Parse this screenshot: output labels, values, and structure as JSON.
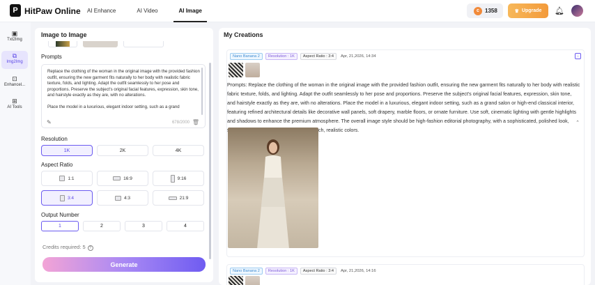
{
  "header": {
    "logo_glyph": "P",
    "brand": "HitPaw Online",
    "nav": [
      {
        "label": "AI Enhance",
        "active": false
      },
      {
        "label": "AI Video",
        "active": false
      },
      {
        "label": "AI Image",
        "active": true
      }
    ],
    "credits": "1358",
    "upgrade_label": "Upgrade"
  },
  "rail": [
    {
      "label": "Txt2Img",
      "icon": "text-image-icon",
      "active": false
    },
    {
      "label": "Img2Img",
      "icon": "image-image-icon",
      "active": true
    },
    {
      "label": "Enhancel...",
      "icon": "enhance-icon",
      "active": false
    },
    {
      "label": "AI Tools",
      "icon": "tools-grid-icon",
      "active": false
    }
  ],
  "left_panel": {
    "title": "Image to Image",
    "prompts_label": "Prompts",
    "prompt_text_p1": "Replace the clothing of the woman in the original image with the provided fashion outfit, ensuring the new garment fits naturally to her body with realistic fabric texture, folds, and lighting. Adapt the outfit seamlessly to her pose and proportions. Preserve the subject's original facial features, expression, skin tone, and hairstyle exactly as they are, with no alterations.",
    "prompt_text_p2": "Place the model in a luxurious, elegant indoor setting, such as a grand",
    "char_count": "678/2000",
    "resolution_label": "Resolution",
    "resolutions": [
      {
        "label": "1K",
        "selected": true
      },
      {
        "label": "2K",
        "selected": false
      },
      {
        "label": "4K",
        "selected": false
      }
    ],
    "aspect_label": "Aspect Ratio",
    "aspect_ratios": [
      {
        "label": "1:1",
        "selected": false
      },
      {
        "label": "16:9",
        "selected": false
      },
      {
        "label": "9:16",
        "selected": false
      },
      {
        "label": "3:4",
        "selected": true
      },
      {
        "label": "4:3",
        "selected": false
      },
      {
        "label": "21:9",
        "selected": false
      }
    ],
    "output_label": "Output Number",
    "outputs": [
      {
        "label": "1",
        "selected": true
      },
      {
        "label": "2",
        "selected": false
      },
      {
        "label": "3",
        "selected": false
      },
      {
        "label": "4",
        "selected": false
      }
    ],
    "credits_required": "Credits required: 5",
    "generate_label": "Generate"
  },
  "creations": {
    "title": "My Creations",
    "cards": [
      {
        "model_tag": "Nano Banana 2",
        "resolution_tag": "Resolution : 1K",
        "aspect_tag": "Aspect Ratio : 3:4",
        "date": "Apr, 21,2026, 14:34",
        "prompt": "Prompts: Replace the clothing of the woman in the original image with the provided fashion outfit, ensuring the new garment fits naturally to her body with realistic fabric texture, folds, and lighting. Adapt the outfit seamlessly to her pose and proportions. Preserve the subject's original facial features, expression, skin tone, and hairstyle exactly as they are, with no alterations. Place the model in a luxurious, elegant indoor setting, such as a grand salon or high-end classical interior, featuring refined architectural details like decorative wall panels, soft drapery, marble floors, or ornate furniture. Use soft, cinematic lighting with gentle highlights and shadows to enhance the premium atmosphere. The overall image style should be high-fashion editorial photography, with a sophisticated, polished look, sharp focus, balanced composition, and rich, realistic colors."
      },
      {
        "model_tag": "Nano Banana 2",
        "resolution_tag": "Resolution : 1K",
        "aspect_tag": "Aspect Ratio : 3:4",
        "date": "Apr, 21,2026, 14:16"
      }
    ]
  }
}
